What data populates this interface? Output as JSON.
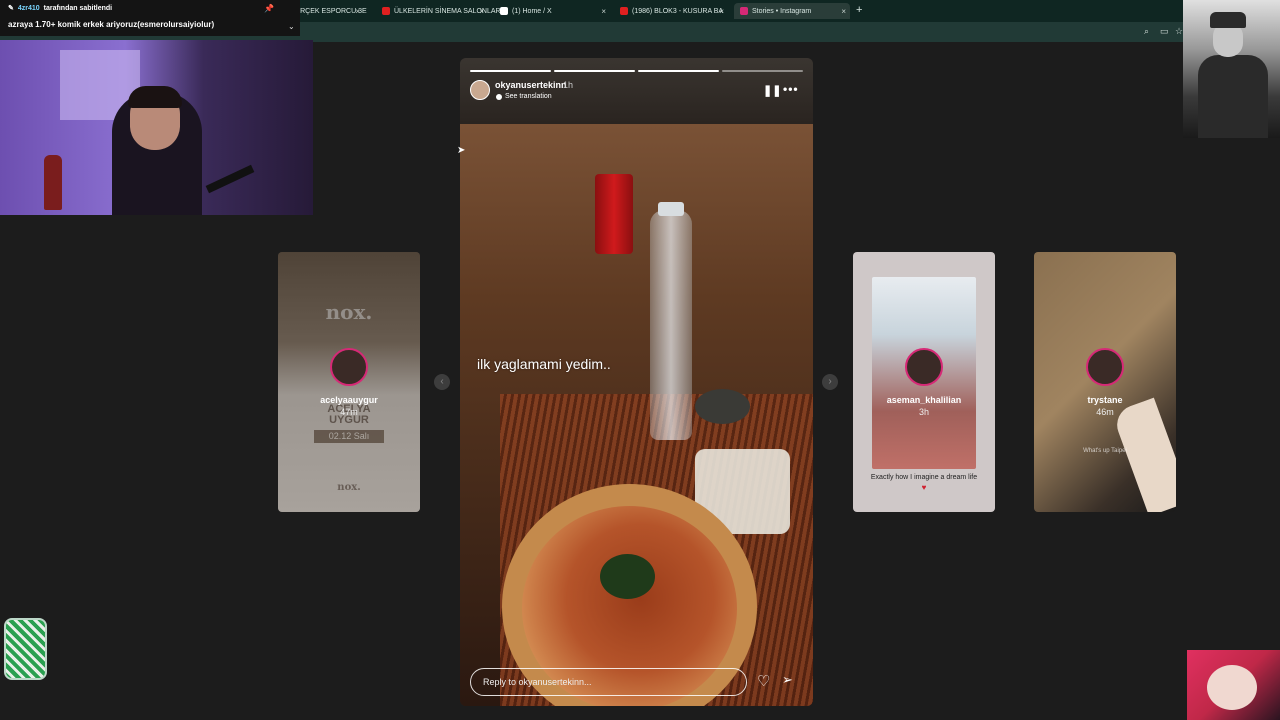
{
  "browser": {
    "tabs": [
      {
        "label": "GERÇEK ESPORCU 3E",
        "favicon_color": "#c8c8c8"
      },
      {
        "label": "ÜLKELERİN SİNEMA SALONLARI",
        "favicon_color": "#e02020"
      },
      {
        "label": "(1) Home / X",
        "favicon_color": "#ffffff"
      },
      {
        "label": "(1986) BLOK3 - KUSURA BA",
        "favicon_color": "#e02020"
      },
      {
        "label": "Stories • Instagram",
        "favicon_color": "#d62976"
      }
    ],
    "new_tab_icon": "+",
    "close_icon": "×",
    "toolbar_icons": [
      "search-icon",
      "screen-icon",
      "star-icon"
    ],
    "tab_color": "#0f2622",
    "address_bar_color": "#213a36"
  },
  "chat": {
    "pin_user": "4zr410",
    "pin_text": "tarafından sabitlendi",
    "message": "azraya 1.70+ komik erkek ariyoruz(esmerolursaiyiolur)"
  },
  "story": {
    "username": "okyanusertekinn",
    "time": "1h",
    "translation": "See translation",
    "caption": "ilk yaglamami yedim..",
    "reply_placeholder": "Reply to okyanusertekinn...",
    "progress_total": 4,
    "progress_done": 3
  },
  "previews": {
    "left": {
      "username": "acelyaauygur",
      "time": "47m",
      "brand": "nox.",
      "brand_small": "nox.",
      "name_line1": "ACELYA",
      "name_line2": "UYGUR",
      "date": "02.12 Salı"
    },
    "right1": {
      "username": "aseman_khalilian",
      "time": "3h",
      "caption": "Exactly how I imagine a dream life",
      "heart": "♥"
    },
    "right2": {
      "username": "trystane",
      "time": "46m",
      "overlay_text": "What's up Taipei"
    }
  },
  "nav": {
    "prev": "‹",
    "next": "›"
  }
}
